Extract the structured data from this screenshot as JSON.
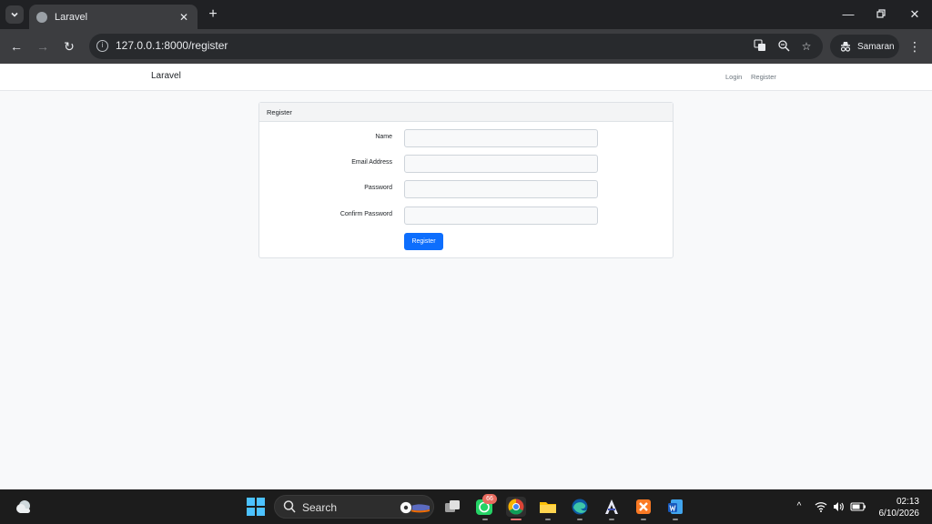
{
  "browser": {
    "tab_title": "Laravel",
    "url": "127.0.0.1:8000/register",
    "profile_name": "Samaran"
  },
  "app": {
    "brand": "Laravel",
    "nav_links": [
      "Login",
      "Register"
    ]
  },
  "register_card": {
    "header": "Register",
    "fields": [
      {
        "label": "Name",
        "value": ""
      },
      {
        "label": "Email Address",
        "value": ""
      },
      {
        "label": "Password",
        "value": ""
      },
      {
        "label": "Confirm Password",
        "value": ""
      }
    ],
    "submit_label": "Register",
    "accent_color": "#0d6efd"
  },
  "taskbar": {
    "search_label": "Search",
    "whatsapp_badge": "66",
    "time": "02:13",
    "date": "6/10/2026"
  }
}
